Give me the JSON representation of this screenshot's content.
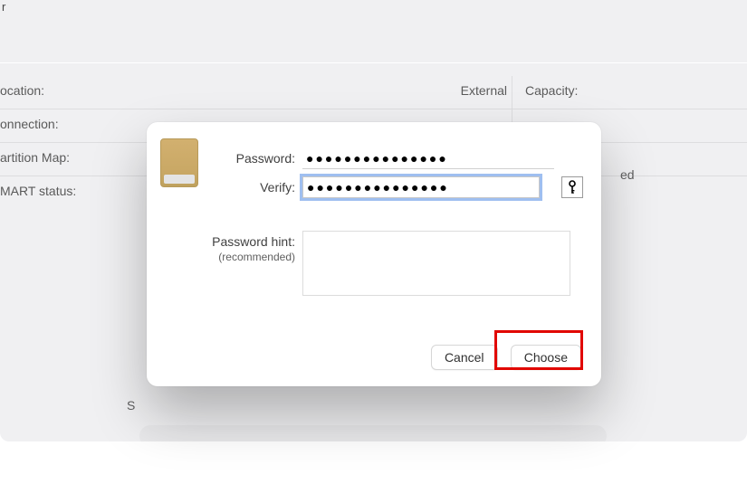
{
  "background": {
    "top_letter": "r",
    "rows": [
      {
        "label_left": "ocation:",
        "value_left": "External",
        "label_right": "Capacity:"
      },
      {
        "label_left": "onnection:",
        "value_left": "",
        "label_right": ""
      },
      {
        "label_left": "artition Map:",
        "value_left": "",
        "label_right": ""
      },
      {
        "label_left": "MART status:",
        "value_left": "",
        "label_right": ""
      }
    ],
    "peek_left": "S",
    "peek_right": "ed"
  },
  "dialog": {
    "password_label": "Password:",
    "verify_label": "Verify:",
    "hint_label": "Password hint:",
    "hint_sub": "(recommended)",
    "password_value": "●●●●●●●●●●●●●●●",
    "verify_value": "●●●●●●●●●●●●●●●",
    "hint_value": "",
    "key_button_title": "Password Assistant",
    "cancel_label": "Cancel",
    "choose_label": "Choose"
  }
}
